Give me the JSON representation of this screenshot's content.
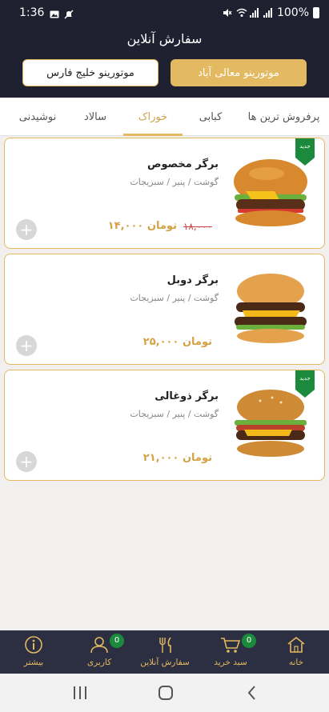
{
  "status_bar": {
    "time": "1:36",
    "battery": "100%"
  },
  "header": {
    "title": "سفارش آنلاین"
  },
  "branches": {
    "active": "موتورینو معالی آباد",
    "inactive": "موتورینو خلیج فارس"
  },
  "tabs": [
    {
      "label": "پرفروش ترین ها"
    },
    {
      "label": "کبابی"
    },
    {
      "label": "خوراک"
    },
    {
      "label": "سالاد"
    },
    {
      "label": "نوشیدنی"
    }
  ],
  "active_tab": "خوراک",
  "products": [
    {
      "name": "برگر مخصوص",
      "ingredients": "گوشت / پنیر / سبزیجات",
      "price": "۱۴,۰۰۰ تومان",
      "old_price": "۱۸,۰۰۰",
      "badge": "جدید"
    },
    {
      "name": "برگر دوبل",
      "ingredients": "گوشت / پنیر / سبزیجات",
      "price": "۲۵,۰۰۰ تومان"
    },
    {
      "name": "برگر ذوغالی",
      "ingredients": "گوشت / پنیر / سبزیجات",
      "price": "۲۱,۰۰۰ تومان",
      "badge": "جدید"
    }
  ],
  "bottom_nav": [
    {
      "label": "خانه",
      "icon": "home-icon"
    },
    {
      "label": "سبد خرید",
      "icon": "cart-icon",
      "badge": "0"
    },
    {
      "label": "سفارش آنلاین",
      "icon": "cutlery-icon"
    },
    {
      "label": "کاربری",
      "icon": "user-icon",
      "badge": "0"
    },
    {
      "label": "بیشتر",
      "icon": "info-icon"
    }
  ],
  "colors": {
    "header_bg": "#1f2131",
    "accent": "#e3b961",
    "price": "#d4a245",
    "badge_green": "#1c8a3c",
    "nav_bg": "#2c2f41"
  }
}
